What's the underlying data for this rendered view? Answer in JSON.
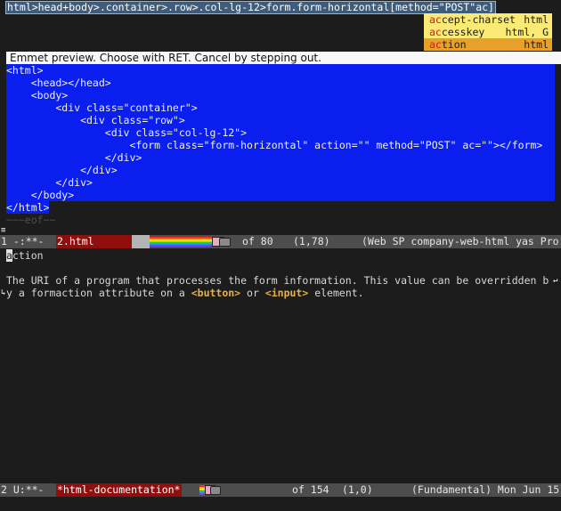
{
  "minibuffer": {
    "input": "html>head+body>.container>.row>.col-lg-12>form.form-horizontal[method=\"POST\"ac]"
  },
  "completion_popup": {
    "items": [
      {
        "match": "ac",
        "rest": "cept-charset",
        "annotation": "html"
      },
      {
        "match": "ac",
        "rest": "cesskey",
        "annotation": "html, G"
      },
      {
        "match": "ac",
        "rest": "tion",
        "annotation": "html"
      }
    ],
    "selected_index": 2
  },
  "emmet_preview": {
    "header": "Emmet preview. Choose with RET. Cancel by stepping out.",
    "code_lines": [
      "<html>",
      "    <head></head>",
      "    <body>",
      "        <div class=\"container\">",
      "            <div class=\"row\">",
      "                <div class=\"col-lg-12\">",
      "                    <form class=\"form-horizontal\" action=\"\" method=\"POST\" ac=\"\"></form>",
      "                </div>",
      "            </div>",
      "        </div>",
      "    </body>",
      "</html>"
    ],
    "eof": "~~~eof~~"
  },
  "modeline_top": {
    "status": "1 -:**-  ",
    "buffer": "2.html",
    "position": "of 80",
    "line_col": "(1,78)",
    "modes": "(Web SP company-web-html yas Pro"
  },
  "documentation": {
    "title_first": "a",
    "title_rest": "ction",
    "line1": "The URI of a program that processes the form information. This value can be overridden b",
    "line1_wrap": "y a formaction attribute on a ",
    "keyword1": "<button>",
    "mid_text": " or ",
    "keyword2": "<input>",
    "tail_text": " element."
  },
  "modeline_bottom": {
    "status": "2 U:**-  ",
    "buffer": "*html-documentation*",
    "position": "of 154",
    "line_col": "(1,0)",
    "modes": "(Fundamental) Mon Jun 15"
  }
}
